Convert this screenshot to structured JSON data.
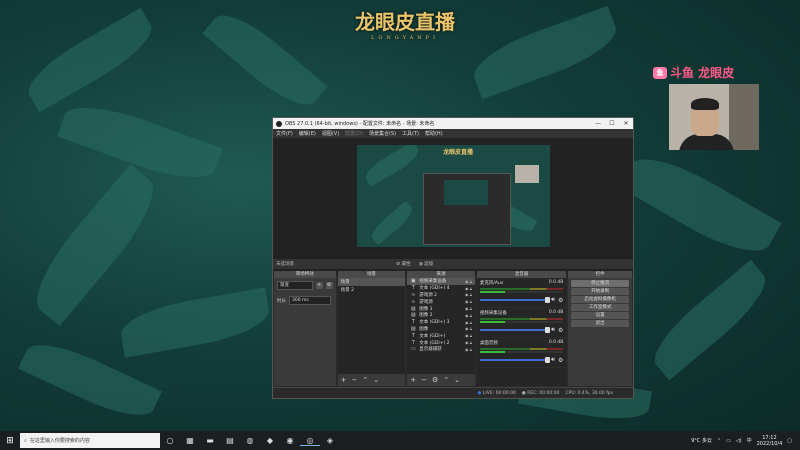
{
  "overlay": {
    "logo_title": "龙眼皮直播",
    "logo_sub": "LONGYANPI",
    "douyu_logo": "鱼",
    "douyu_text": "斗鱼 龙眼皮"
  },
  "obs": {
    "window_title": "OBS 27.0.1 (64-bit, windows) - 配置文件: 未命名 - 场景: 未命名",
    "menu": [
      {
        "label": "文件(F)",
        "dim": false
      },
      {
        "label": "编辑(E)",
        "dim": false
      },
      {
        "label": "视图(V)",
        "dim": false
      },
      {
        "label": "配置(D)",
        "dim": true
      },
      {
        "label": "场景集合(S)",
        "dim": false
      },
      {
        "label": "工具(T)",
        "dim": false
      },
      {
        "label": "帮助(H)",
        "dim": false
      }
    ],
    "preview_title": "龙眼皮直播",
    "current_scene_label": "未选场景",
    "scene_controls": [
      "属性",
      "滤镜"
    ],
    "docks": {
      "transitions": {
        "header": "转场特效",
        "type": "渐变",
        "duration_label": "时长",
        "duration_value": "300 ms"
      },
      "scenes": {
        "header": "场景",
        "items": [
          "场景",
          "场景 2"
        ]
      },
      "sources": {
        "header": "来源",
        "items": [
          {
            "icon": "▣",
            "label": "视频采集设备"
          },
          {
            "icon": "T",
            "label": "文本 (GDI+) 4"
          },
          {
            "icon": "∞",
            "label": "游戏源 2"
          },
          {
            "icon": "∞",
            "label": "游戏源"
          },
          {
            "icon": "▨",
            "label": "图像 3"
          },
          {
            "icon": "▨",
            "label": "图像 2"
          },
          {
            "icon": "T",
            "label": "文本 (GDI+) 3"
          },
          {
            "icon": "▨",
            "label": "图像"
          },
          {
            "icon": "T",
            "label": "文本 (GDI+)"
          },
          {
            "icon": "T",
            "label": "文本 (GDI+) 2"
          },
          {
            "icon": "▭",
            "label": "显示器捕获"
          }
        ]
      },
      "mixer": {
        "header": "混音器",
        "channels": [
          {
            "name": "麦克风/Aux",
            "db": "0.0 dB"
          },
          {
            "name": "视频采集设备",
            "db": "0.0 dB"
          },
          {
            "name": "桌面音频",
            "db": "0.0 dB"
          }
        ]
      },
      "controls": {
        "header": "控件",
        "buttons": [
          {
            "label": "停止推流",
            "active": true
          },
          {
            "label": "开始录制",
            "active": false
          },
          {
            "label": "启动虚拟摄像机",
            "active": false
          },
          {
            "label": "工作室模式",
            "active": false
          },
          {
            "label": "设置",
            "active": false
          },
          {
            "label": "退出",
            "active": false
          }
        ]
      }
    },
    "status": {
      "live": "LIVE: 00:00:00",
      "rec": "REC: 00:00:00",
      "cpu": "CPU: 0.4%, 30.00 fps"
    }
  },
  "taskbar": {
    "search_placeholder": "在这里输入你要搜索的内容",
    "weather": "9°C 多云",
    "ime": "中",
    "time": "17:12",
    "date": "2022/10/4"
  }
}
